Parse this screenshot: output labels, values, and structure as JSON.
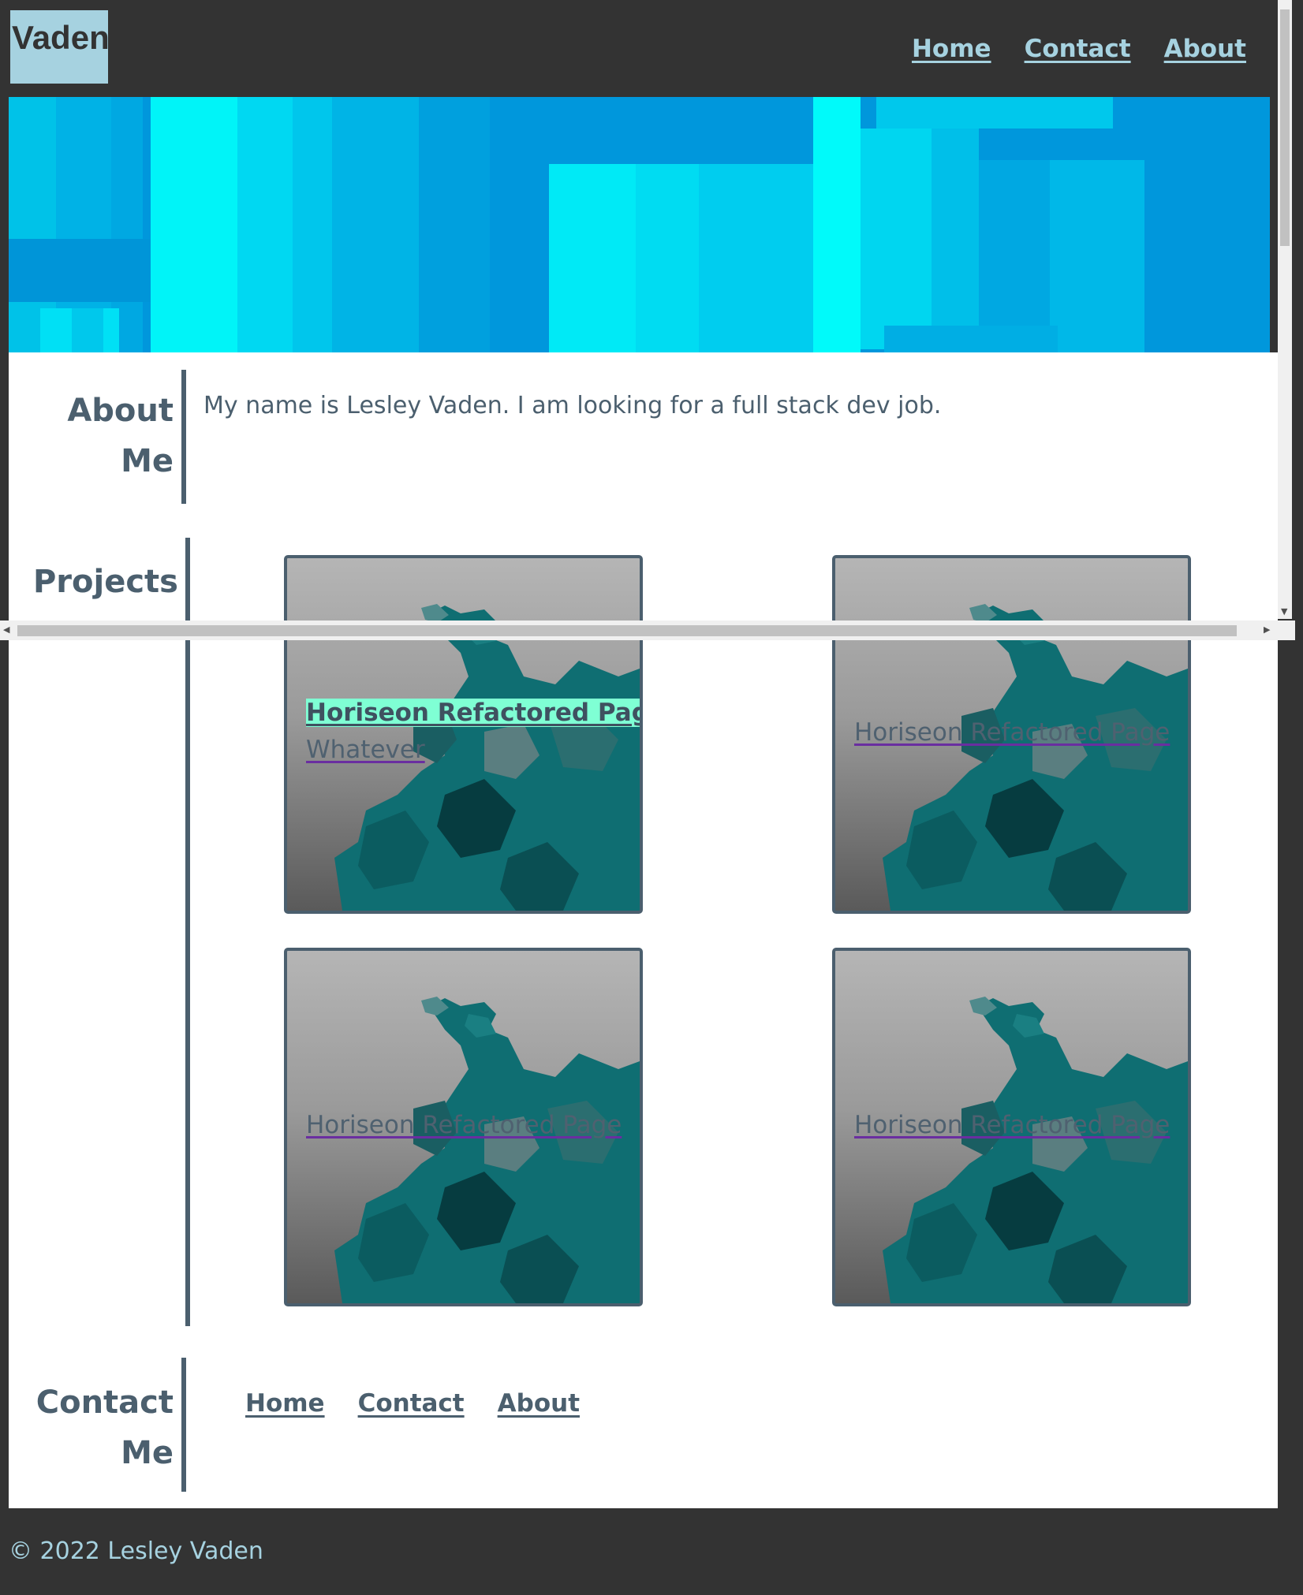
{
  "header": {
    "logo": "Vaden",
    "nav": [
      "Home",
      "Contact",
      "About"
    ]
  },
  "about": {
    "title_line1": "About",
    "title_line2": "Me",
    "text": "My name is Lesley Vaden. I am looking for a full stack dev job."
  },
  "projects": {
    "title": "Projects",
    "cards": [
      {
        "link": "Horiseon Refactored Page",
        "sublink": "Whatever"
      },
      {
        "link": "Horiseon Refactored Page"
      },
      {
        "link": "Horiseon Refactored Page"
      },
      {
        "link": "Horiseon Refactored Page"
      }
    ]
  },
  "contact": {
    "title_line1": "Contact",
    "title_line2": "Me",
    "nav": [
      "Home",
      "Contact",
      "About"
    ]
  },
  "footer": {
    "copyright": "© 2022 Lesley Vaden"
  },
  "colors": {
    "dark_bg": "#333333",
    "accent_light_blue": "#a6d2e0",
    "slate_text": "#4b5f6e",
    "hover_highlight": "#7fffd4"
  },
  "icons": {
    "scroll_up": "▲",
    "scroll_down": "▼",
    "scroll_left": "◀",
    "scroll_right": "▶"
  }
}
